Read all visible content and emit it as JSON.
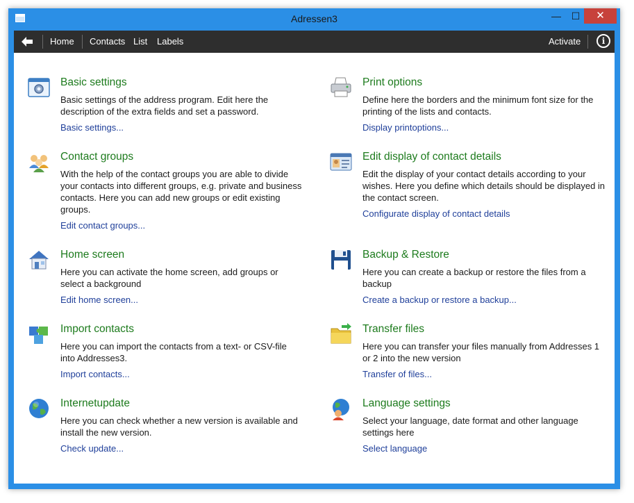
{
  "window": {
    "title": "Adressen3"
  },
  "titlebar": {
    "min": "—",
    "max": "☐",
    "close": "✕"
  },
  "toolbar": {
    "items": [
      "Home",
      "Contacts",
      "List",
      "Labels"
    ],
    "activate": "Activate",
    "info": "i"
  },
  "left": [
    {
      "title": "Basic settings",
      "desc": "Basic settings of the address program. Edit here the description of the extra fields and set a password.",
      "link": "Basic settings...",
      "icon": "settings-icon"
    },
    {
      "title": "Contact groups",
      "desc": "With the help of the contact groups you are able to divide your contacts into different groups, e.g. private and business contacts. Here you can add new groups or edit existing groups.",
      "link": "Edit contact groups...",
      "icon": "contact-groups-icon"
    },
    {
      "title": "Home screen",
      "desc": "Here you can activate the home screen, add groups or select a background",
      "link": "Edit home screen...",
      "icon": "home-icon"
    },
    {
      "title": "Import contacts",
      "desc": "Here you can import the contacts from a text- or CSV-file into Addresses3.",
      "link": "Import contacts...",
      "icon": "puzzle-icon"
    },
    {
      "title": "Internetupdate",
      "desc": "Here you can check whether a new version is available and install the new version.",
      "link": "Check update...",
      "icon": "globe-icon"
    }
  ],
  "right": [
    {
      "title": "Print options",
      "desc": "Define here the borders and the minimum font size for the printing of the lists and contacts.",
      "link": "Display printoptions...",
      "icon": "printer-icon"
    },
    {
      "title": "Edit display of contact details",
      "desc": "Edit the display of your contact details according to your wishes. Here you define which details should be displayed in the contact screen.",
      "link": "Configurate display of contact details",
      "icon": "contact-card-icon"
    },
    {
      "title": "Backup & Restore",
      "desc": "Here you can create a backup or restore the files from a backup",
      "link": "Create a backup or restore a backup...",
      "icon": "floppy-disk-icon"
    },
    {
      "title": "Transfer files",
      "desc": "Here you can transfer your files manually from Addresses 1 or 2 into the new version",
      "link": "Transfer of files...",
      "icon": "folder-transfer-icon"
    },
    {
      "title": "Language settings",
      "desc": "Select your language, date format and other language settings here",
      "link": "Select language",
      "icon": "language-icon"
    }
  ]
}
